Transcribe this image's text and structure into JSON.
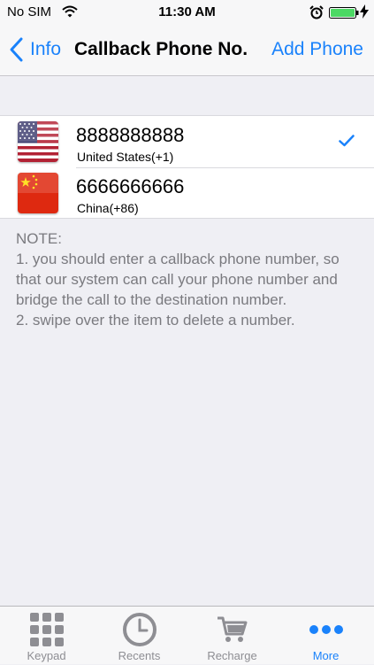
{
  "status_bar": {
    "carrier": "No SIM",
    "time": "11:30 AM"
  },
  "nav": {
    "back_label": "Info",
    "title": "Callback Phone No.",
    "action_label": "Add Phone"
  },
  "phones": [
    {
      "number": "8888888888",
      "country": "United States(+1)",
      "flag": "us-flag",
      "selected": true
    },
    {
      "number": "6666666666",
      "country": "China(+86)",
      "flag": "china-flag",
      "selected": false
    }
  ],
  "note": {
    "title": "NOTE:",
    "line1": "1. you should enter a callback phone number, so that our system can call your phone number and bridge the call to the destination number.",
    "line2": "2. swipe over the item to delete a number."
  },
  "tabs": [
    {
      "label": "Keypad",
      "icon": "keypad-icon"
    },
    {
      "label": "Recents",
      "icon": "clock-icon"
    },
    {
      "label": "Recharge",
      "icon": "cart-icon"
    },
    {
      "label": "More",
      "icon": "more-icon",
      "active": true
    }
  ],
  "colors": {
    "accent": "#1a82fb",
    "background": "#efeff4",
    "note_text": "#7a7a7f",
    "battery": "#4cd964"
  }
}
